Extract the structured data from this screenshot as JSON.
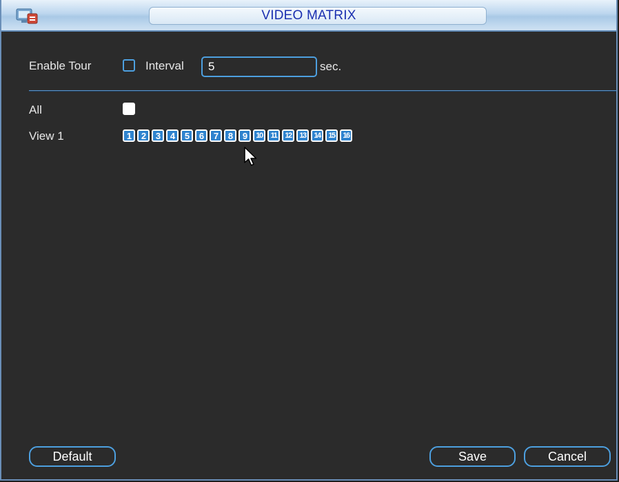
{
  "window": {
    "title": "VIDEO MATRIX",
    "accent_color": "#4da0e0",
    "title_color": "#1a2fb0"
  },
  "tour": {
    "enable_label": "Enable Tour",
    "enable_checked": false,
    "interval_label": "Interval",
    "interval_value": "5",
    "interval_unit": "sec."
  },
  "views": {
    "all_label": "All",
    "all_checked": true,
    "view1_label": "View 1",
    "channels": [
      "1",
      "2",
      "3",
      "4",
      "5",
      "6",
      "7",
      "8",
      "9",
      "10",
      "11",
      "12",
      "13",
      "14",
      "15",
      "16"
    ]
  },
  "buttons": {
    "default_label": "Default",
    "save_label": "Save",
    "cancel_label": "Cancel"
  },
  "icons": {
    "title_icon": "system-settings-icon",
    "cursor": "mouse-pointer-icon"
  }
}
